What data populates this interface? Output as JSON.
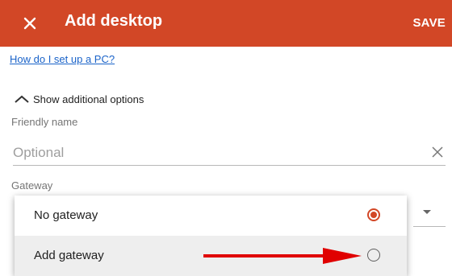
{
  "header": {
    "title": "Add desktop",
    "save_label": "SAVE",
    "close_icon": "close-icon",
    "background_color": "#d24726"
  },
  "help_link": "How do I set up a PC?",
  "additional_options": {
    "label": "Show additional options",
    "icon": "chevron-up-icon"
  },
  "friendly_name": {
    "label": "Friendly name",
    "placeholder": "Optional",
    "value": ""
  },
  "gateway": {
    "label": "Gateway",
    "options": [
      {
        "label": "No gateway",
        "selected": true
      },
      {
        "label": "Add gateway",
        "selected": false
      }
    ]
  },
  "colors": {
    "accent": "#d24726",
    "link": "#1a63c9",
    "annotation_arrow": "#e00000"
  }
}
